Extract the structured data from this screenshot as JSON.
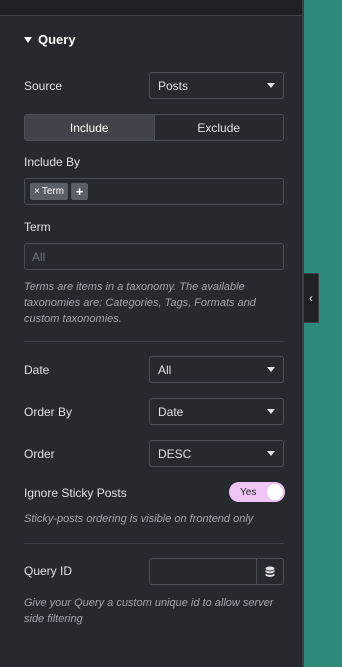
{
  "section": {
    "title": "Query",
    "icon": "caret-down-icon"
  },
  "source": {
    "label": "Source",
    "value": "Posts"
  },
  "tabs": [
    {
      "label": "Include",
      "active": true
    },
    {
      "label": "Exclude",
      "active": false
    }
  ],
  "include_by": {
    "label": "Include By",
    "tag": "Term",
    "tag_remove": "×",
    "add": "+"
  },
  "term": {
    "label": "Term",
    "placeholder": "All"
  },
  "term_help": "Terms are items in a taxonomy. The available taxonomies are: Categories, Tags, Formats and custom taxonomies.",
  "date": {
    "label": "Date",
    "value": "All"
  },
  "order_by": {
    "label": "Order By",
    "value": "Date"
  },
  "order": {
    "label": "Order",
    "value": "DESC"
  },
  "sticky": {
    "label": "Ignore Sticky Posts",
    "toggle_text": "Yes",
    "help": "Sticky-posts ordering is visible on frontend only"
  },
  "query_id": {
    "label": "Query ID",
    "value": "",
    "help": "Give your Query a custom unique id to allow server side filtering"
  },
  "colors": {
    "background": "#26292e",
    "accent_teal": "#2e8a7a",
    "toggle_on": "#f0c4f4"
  }
}
